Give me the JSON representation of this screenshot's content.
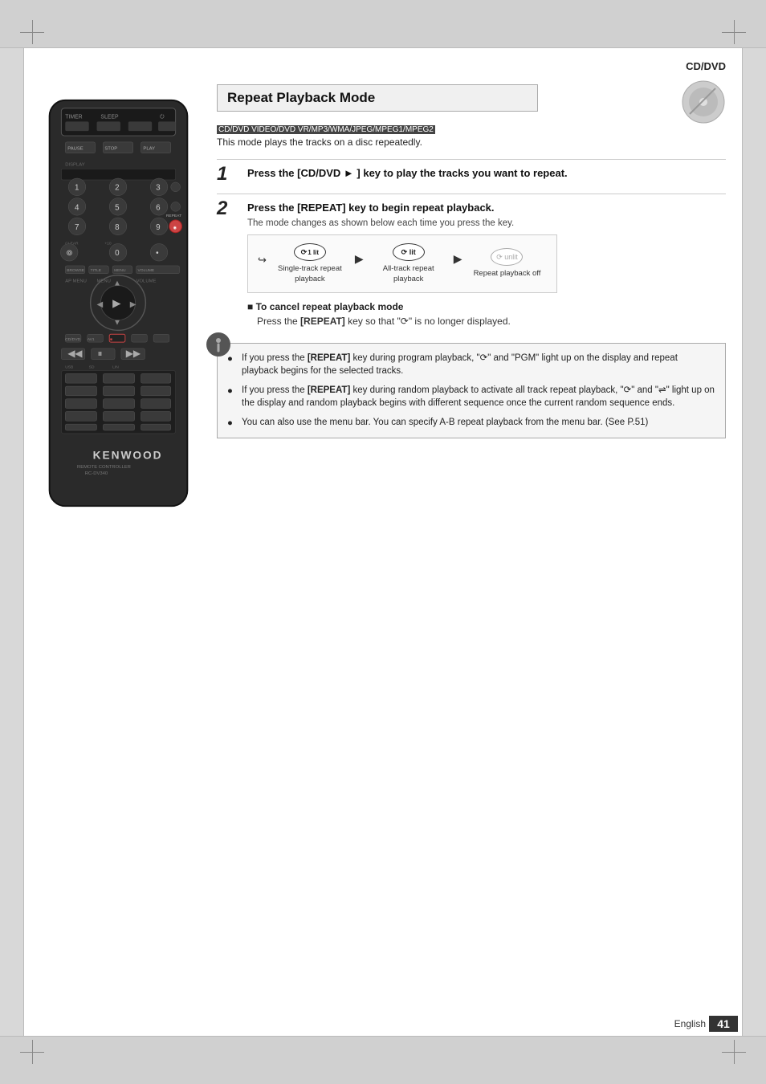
{
  "page": {
    "title": "CD/DVD",
    "language": "English",
    "page_number": "41"
  },
  "section": {
    "title": "Repeat Playback Mode",
    "compat_label": "CD/DVD VIDEO/DVD VR/MP3/WMA/JPEG/MPEG1/MPEG2",
    "description": "This mode plays the tracks on a disc repeatedly.",
    "steps": [
      {
        "number": "1",
        "text": "Press the [CD/DVD ► ] key to play the tracks you want to repeat."
      },
      {
        "number": "2",
        "text": "Press the [REPEAT] key to begin repeat playback."
      }
    ],
    "mode_change_label": "The mode changes as shown below each time you press the key.",
    "modes": [
      {
        "icon_text": "1 lit",
        "style": "lit",
        "label": "Single-track repeat playback"
      },
      {
        "icon_text": "lit",
        "style": "lit",
        "label": "All-track repeat playback"
      },
      {
        "icon_text": "unlit",
        "style": "unlit",
        "label": "Repeat playback off"
      }
    ],
    "cancel_title": "To cancel repeat playback mode",
    "cancel_text": "Press the [REPEAT] key so that \"⟳\" is no longer displayed.",
    "notes": [
      "If you press the [REPEAT] key during program playback, \"⟳\" and \"PGM\" light up on the display and repeat playback begins for the selected tracks.",
      "If you press the [REPEAT] key during random playback to activate all track repeat playback, \"⟳\" and \"⇌\" light up on the display and random playback begins with different sequence once the current random sequence ends.",
      "You can also use the menu bar. You can specify A-B repeat playback from the menu bar. (See P.51)"
    ]
  },
  "remote": {
    "brand": "KENWOOD",
    "model": "RC-DV340"
  }
}
